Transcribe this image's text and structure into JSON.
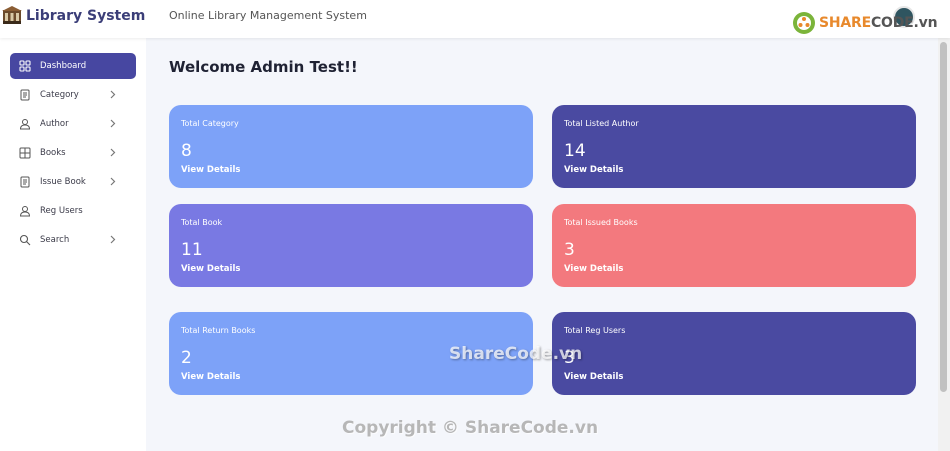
{
  "header": {
    "brand": "Library System",
    "title": "Online Library Management System"
  },
  "sidebar": {
    "items": [
      {
        "label": "Dashboard",
        "icon": "dashboard-grid-icon",
        "active": true
      },
      {
        "label": "Category",
        "icon": "document-icon",
        "has_submenu": true
      },
      {
        "label": "Author",
        "icon": "user-icon",
        "has_submenu": true
      },
      {
        "label": "Books",
        "icon": "table-icon",
        "has_submenu": true
      },
      {
        "label": "Issue Book",
        "icon": "document-icon",
        "has_submenu": true
      },
      {
        "label": "Reg Users",
        "icon": "user-icon"
      },
      {
        "label": "Search",
        "icon": "search-icon",
        "has_submenu": true
      }
    ]
  },
  "main": {
    "welcome": "Welcome Admin Test!!",
    "cards": [
      {
        "title": "Total Category",
        "value": "8",
        "link": "View Details",
        "color": "#7da2f8"
      },
      {
        "title": "Total Listed Author",
        "value": "14",
        "link": "View Details",
        "color": "#4a4aa1"
      },
      {
        "title": "Total Book",
        "value": "11",
        "link": "View Details",
        "color": "#7979e3"
      },
      {
        "title": "Total Issued Books",
        "value": "3",
        "link": "View Details",
        "color": "#f3797e"
      },
      {
        "title": "Total Return Books",
        "value": "2",
        "link": "View Details",
        "color": "#7da2f8"
      },
      {
        "title": "Total Reg Users",
        "value": "3",
        "link": "View Details",
        "color": "#4a4aa1"
      }
    ]
  },
  "watermarks": {
    "logo_prefix": "SHARE",
    "logo_suffix": "CODE",
    "logo_tld": ".vn",
    "middle": "ShareCode.vn",
    "bottom": "Copyright © ShareCode.vn"
  },
  "colors": {
    "primary": "#4747a1",
    "background": "#f4f6fb",
    "accent_orange": "#e8892c"
  }
}
